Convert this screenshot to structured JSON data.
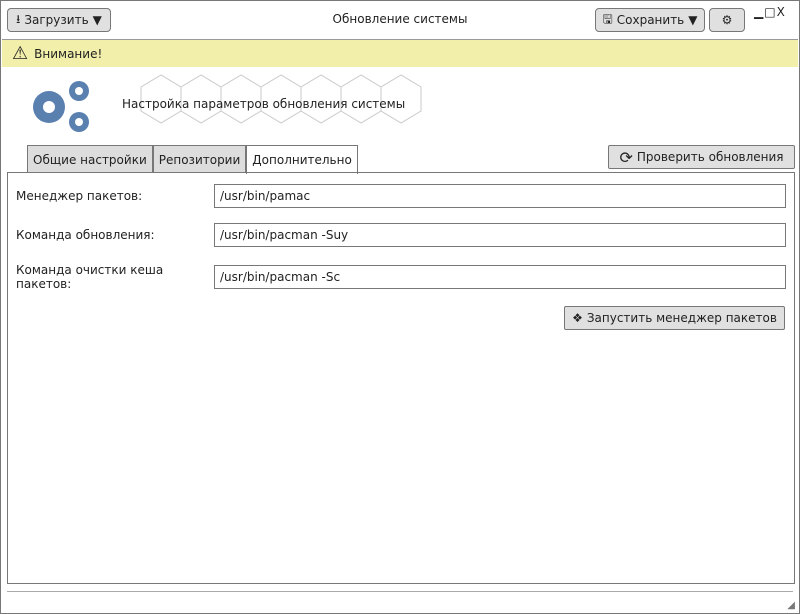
{
  "window": {
    "title": "Обновление системы"
  },
  "toolbar": {
    "load_label": "Загрузить",
    "save_label": "Сохранить"
  },
  "alert": {
    "text": "Внимание!"
  },
  "header": {
    "text": "Настройка параметров обновления системы"
  },
  "tabs": [
    {
      "label": "Общие настройки"
    },
    {
      "label": "Репозитории"
    },
    {
      "label": "Дополнительно"
    }
  ],
  "check_updates_label": "Проверить обновления",
  "fields": [
    {
      "label": "Менеджер пакетов:",
      "value": "/usr/bin/pamac"
    },
    {
      "label": "Команда обновления:",
      "value": "/usr/bin/pacman -Suy"
    },
    {
      "label": "Команда очистки кеша пакетов:",
      "value": "/usr/bin/pacman -Sc"
    }
  ],
  "run_manager_label": "Запустить менеджер пакетов",
  "colors": {
    "alert_bg": "#f2efab",
    "gear": "#5a80b0"
  }
}
